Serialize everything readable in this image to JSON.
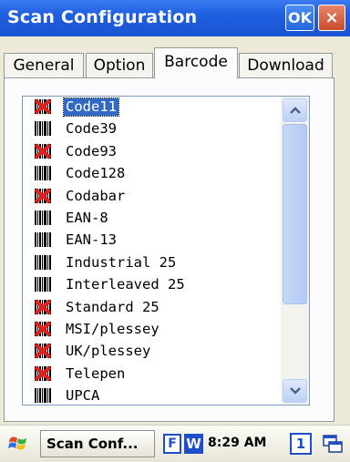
{
  "window": {
    "title": "Scan Configuration",
    "ok_label": "OK",
    "close_label": "×",
    "title_bar_color": "#1f5fe0"
  },
  "tabs": [
    {
      "label": "General",
      "active": false
    },
    {
      "label": "Option",
      "active": false
    },
    {
      "label": "Barcode",
      "active": true
    },
    {
      "label": "Download",
      "active": false
    }
  ],
  "barcode_list": {
    "selected": "Code11",
    "selection_color": "#316ac5",
    "items": [
      {
        "label": "Code11",
        "enabled": false
      },
      {
        "label": "Code39",
        "enabled": true
      },
      {
        "label": "Code93",
        "enabled": false
      },
      {
        "label": "Code128",
        "enabled": true
      },
      {
        "label": "Codabar",
        "enabled": false
      },
      {
        "label": "EAN-8",
        "enabled": true
      },
      {
        "label": "EAN-13",
        "enabled": true
      },
      {
        "label": "Industrial 25",
        "enabled": true
      },
      {
        "label": "Interleaved 25",
        "enabled": true
      },
      {
        "label": "Standard 25",
        "enabled": false
      },
      {
        "label": "MSI/plessey",
        "enabled": false
      },
      {
        "label": "UK/plessey",
        "enabled": false
      },
      {
        "label": "Telepen",
        "enabled": false
      },
      {
        "label": "UPCA",
        "enabled": true
      }
    ],
    "icons": {
      "enabled": "barcode-icon",
      "disabled": "barcode-disabled-icon"
    }
  },
  "taskbar": {
    "task_label": "Scan Conf...",
    "tray_f": "F",
    "tray_w": "W",
    "clock": "8:29 AM",
    "tray_input": "1"
  }
}
